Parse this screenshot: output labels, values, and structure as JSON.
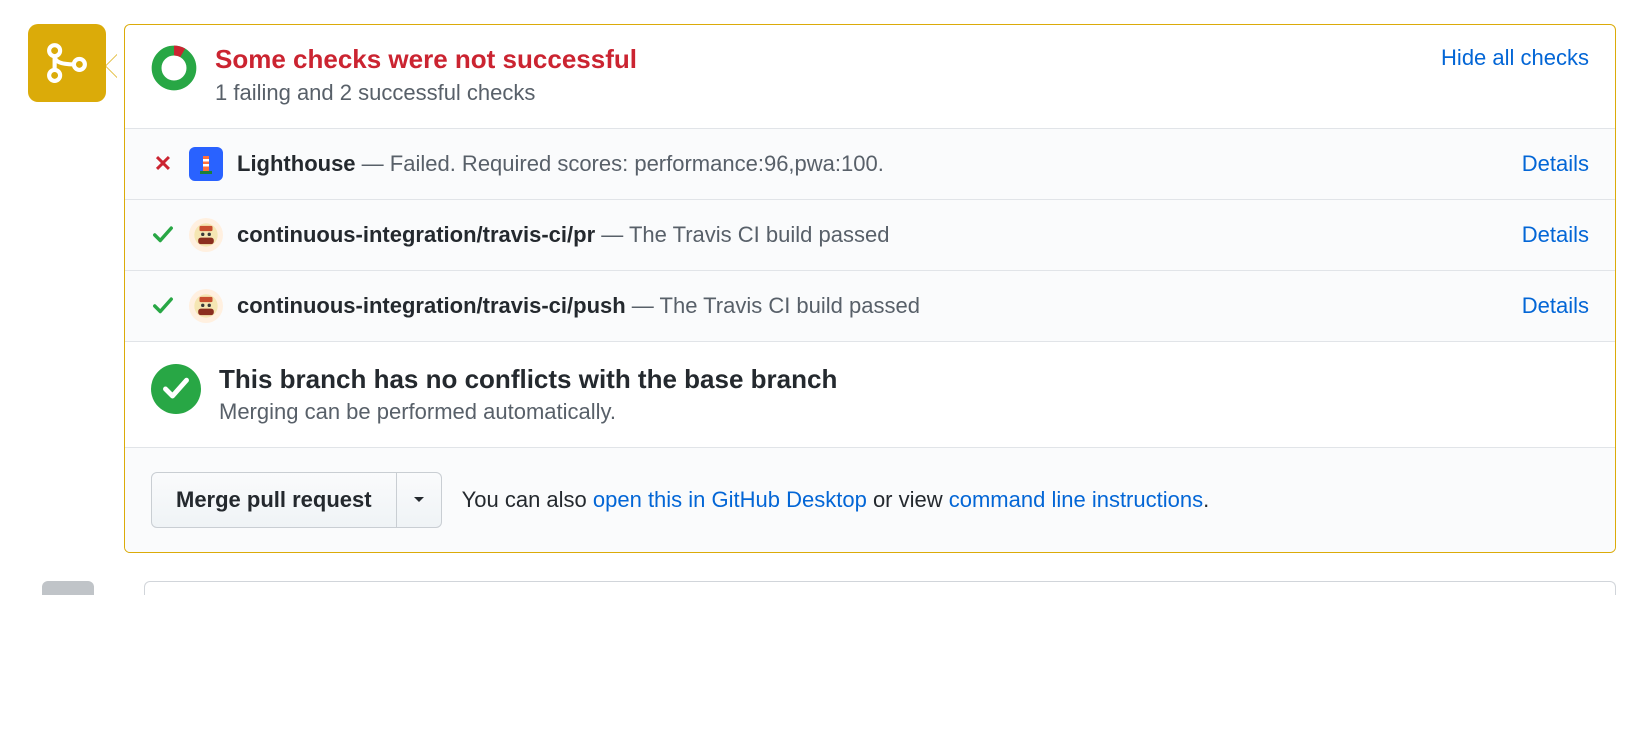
{
  "header": {
    "status_heading": "Some checks were not successful",
    "status_sub": "1 failing and 2 successful checks",
    "hide_link": "Hide all checks"
  },
  "checks": [
    {
      "status": "fail",
      "avatar": "lighthouse",
      "name": "Lighthouse",
      "sep": " — ",
      "desc": "Failed. Required scores: performance:96,pwa:100.",
      "details": "Details"
    },
    {
      "status": "pass",
      "avatar": "travis",
      "name": "continuous-integration/travis-ci/pr",
      "sep": " — ",
      "desc": "The Travis CI build passed",
      "details": "Details"
    },
    {
      "status": "pass",
      "avatar": "travis",
      "name": "continuous-integration/travis-ci/push",
      "sep": " — ",
      "desc": "The Travis CI build passed",
      "details": "Details"
    }
  ],
  "merge_status": {
    "heading": "This branch has no conflicts with the base branch",
    "sub": "Merging can be performed automatically."
  },
  "merge_actions": {
    "button": "Merge pull request",
    "info_prefix": "You can also ",
    "link_desktop": "open this in GitHub Desktop",
    "info_mid": " or view ",
    "link_cli": "command line instructions",
    "info_suffix": "."
  }
}
